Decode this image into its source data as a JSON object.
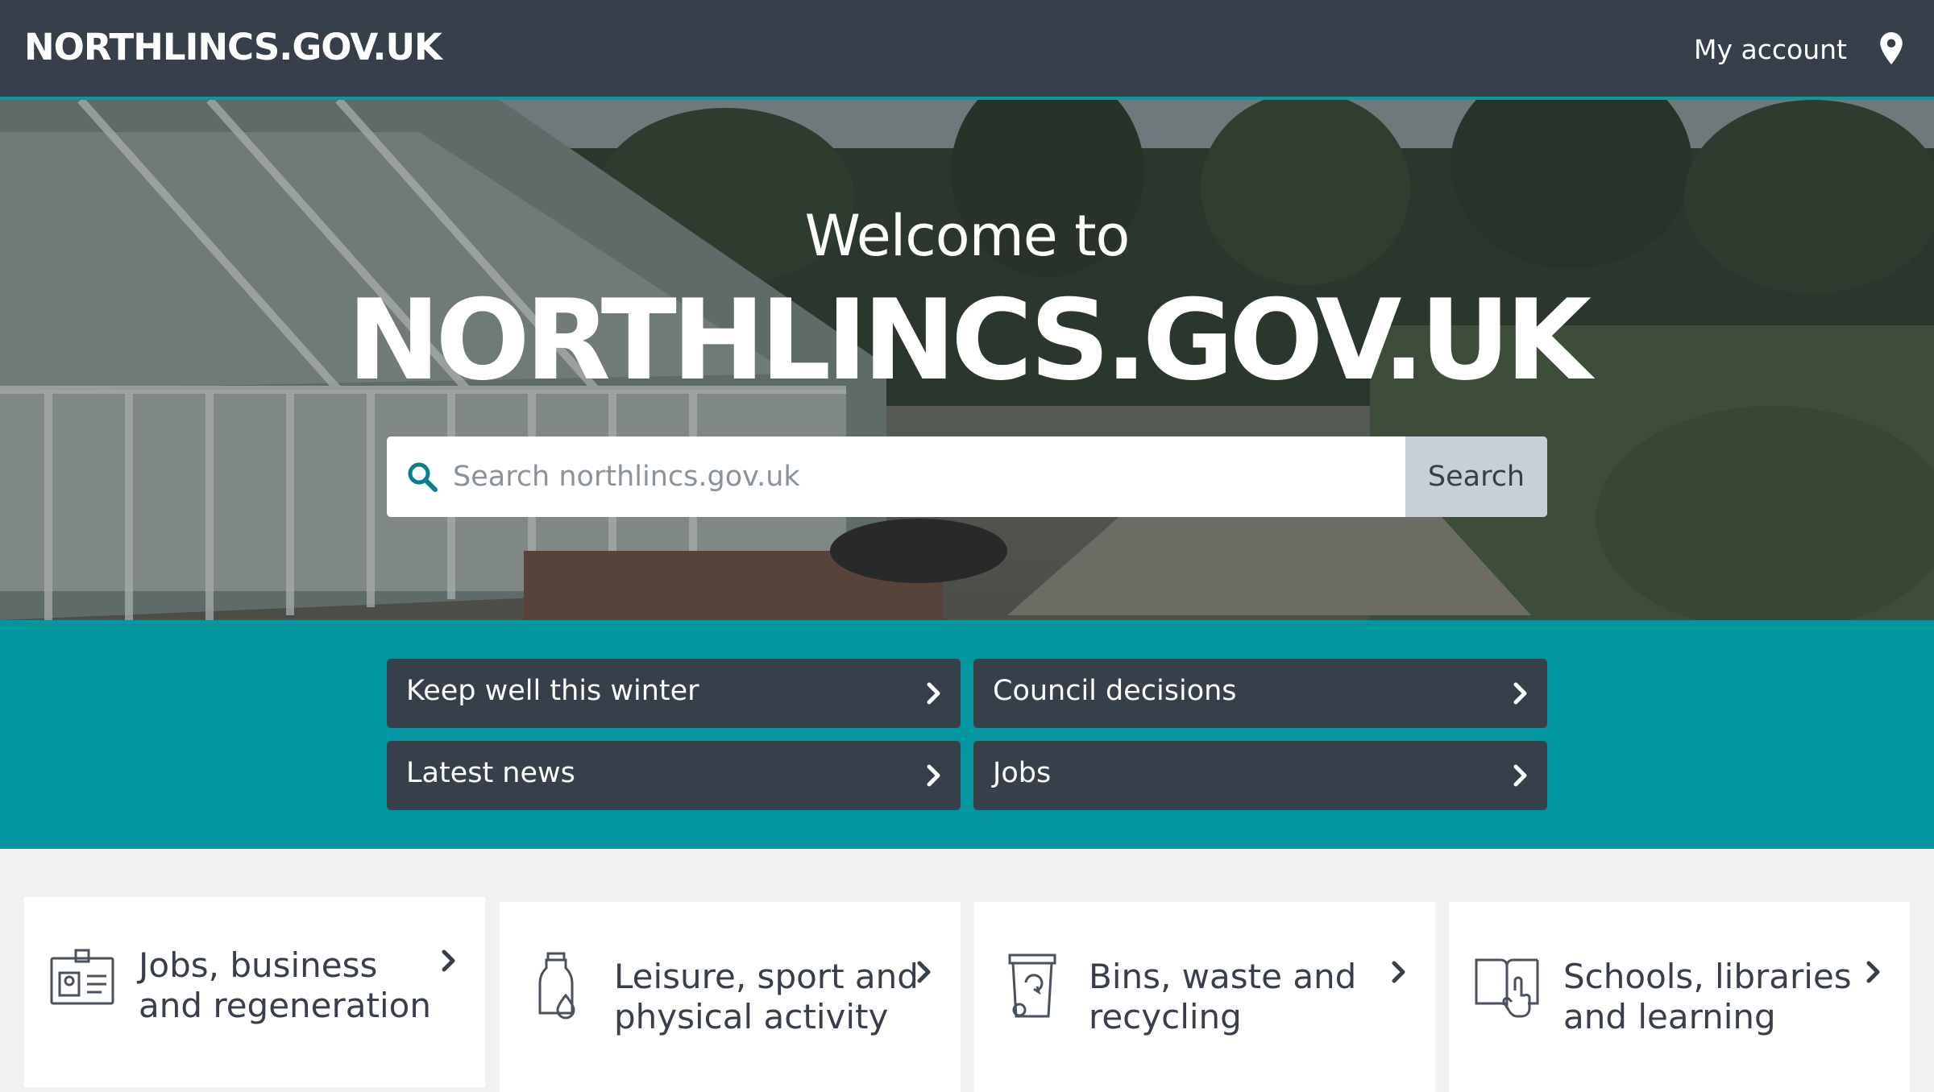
{
  "header": {
    "logo": "NORTHLINCS.GOV.UK",
    "account_label": "My account",
    "location_icon": "map-pin-icon"
  },
  "hero": {
    "welcome": "Welcome to",
    "title": "NORTHLINCS.GOV.UK",
    "search": {
      "placeholder": "Search northlincs.gov.uk",
      "value": "",
      "button_label": "Search"
    }
  },
  "quick_links": [
    {
      "label": "Keep well this winter"
    },
    {
      "label": "Council decisions"
    },
    {
      "label": "Latest news"
    },
    {
      "label": "Jobs"
    }
  ],
  "cards": [
    {
      "label": "Jobs, business and regeneration",
      "icon": "id-badge-icon"
    },
    {
      "label": "Leisure, sport and physical activity",
      "icon": "water-bottle-icon"
    },
    {
      "label": "Bins, waste and recycling",
      "icon": "recycling-bin-icon"
    },
    {
      "label": "Schools, libraries and learning",
      "icon": "book-pointer-icon"
    }
  ],
  "colors": {
    "header_bg": "#37404a",
    "accent_teal": "#00959f",
    "button_dark": "#37404a",
    "search_button": "#c9d0d5"
  }
}
